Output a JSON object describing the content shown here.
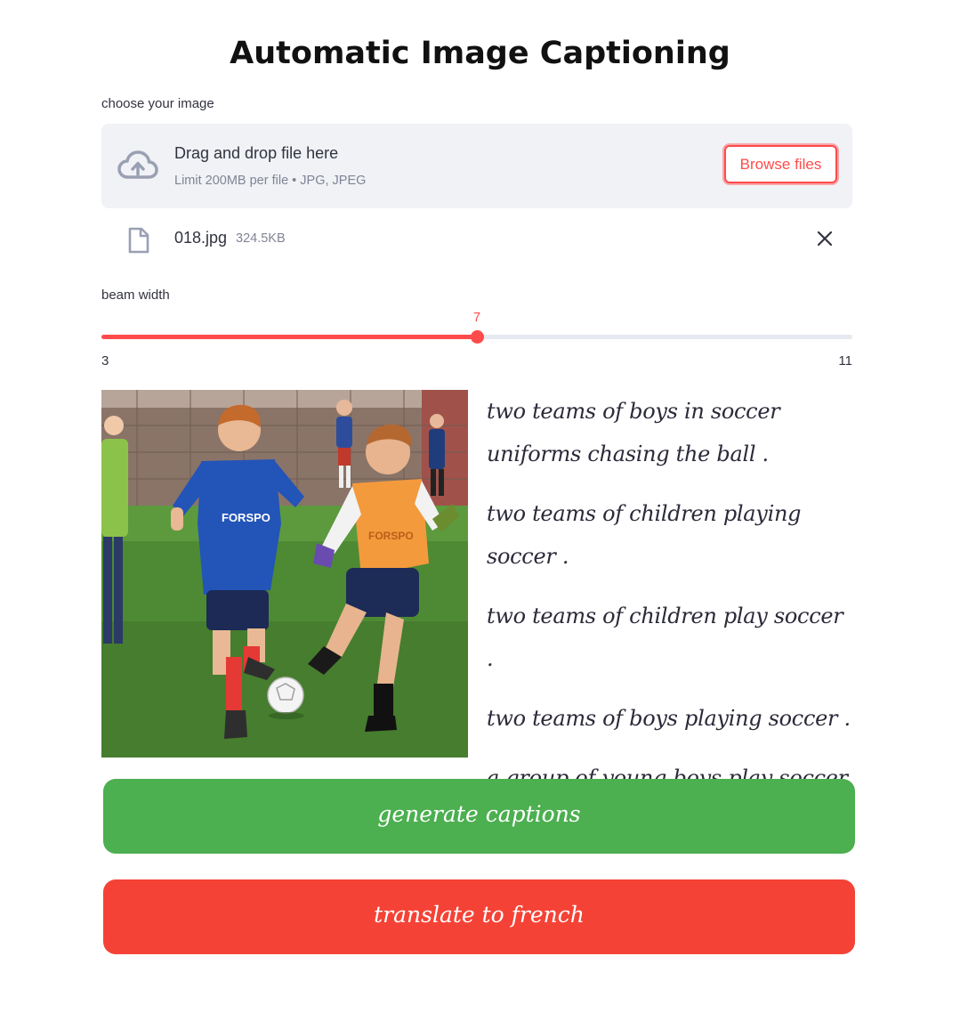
{
  "page_title": "Automatic Image Captioning",
  "uploader": {
    "label": "choose your image",
    "drag_drop_text": "Drag and drop file here",
    "limit_text": "Limit 200MB per file • JPG, JPEG",
    "browse_label": "Browse files",
    "icon": "cloud-upload-icon"
  },
  "uploaded_file": {
    "name": "018.jpg",
    "size": "324.5KB",
    "icon": "file-icon",
    "remove_icon": "close-icon"
  },
  "slider": {
    "label": "beam width",
    "value": 7,
    "min": 3,
    "max": 11,
    "value_text": "7",
    "min_text": "3",
    "max_text": "11",
    "accent_color": "#ff4b4b"
  },
  "image": {
    "description_icon": "photo"
  },
  "captions": [
    "two teams of boys in soccer uniforms chasing the ball .",
    "two teams of children playing soccer .",
    "two teams of children play soccer .",
    "two teams of boys playing soccer .",
    "a group of young boys play soccer ."
  ],
  "buttons": {
    "generate_label": "generate captions",
    "generate_color": "#4caf50",
    "translate_label": "translate to french",
    "translate_color": "#f44336"
  }
}
